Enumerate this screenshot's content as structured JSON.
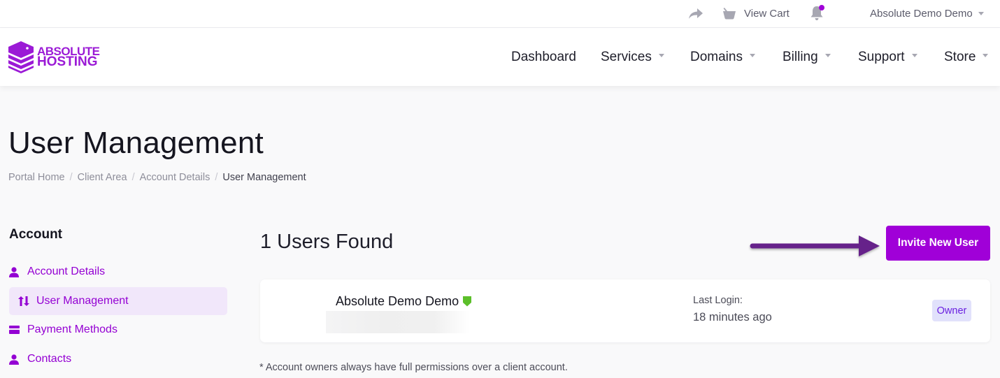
{
  "topbar": {
    "share_icon": "share-arrow-icon",
    "cart_icon": "basket-icon",
    "view_cart_label": "View Cart",
    "notifications_icon": "bell-icon",
    "user_menu_label": "Absolute Demo Demo"
  },
  "brand": {
    "line1": "ABSOLUTE",
    "line2": "HOSTING",
    "color": "#9b1ad6"
  },
  "nav": {
    "items": [
      {
        "label": "Dashboard",
        "has_dropdown": false
      },
      {
        "label": "Services",
        "has_dropdown": true
      },
      {
        "label": "Domains",
        "has_dropdown": true
      },
      {
        "label": "Billing",
        "has_dropdown": true
      },
      {
        "label": "Support",
        "has_dropdown": true
      },
      {
        "label": "Store",
        "has_dropdown": true
      }
    ]
  },
  "page": {
    "title": "User Management",
    "breadcrumb": [
      {
        "label": "Portal Home"
      },
      {
        "label": "Client Area"
      },
      {
        "label": "Account Details"
      },
      {
        "label": "User Management",
        "active": true
      }
    ]
  },
  "sidebar": {
    "title": "Account",
    "items": [
      {
        "label": "Account Details",
        "icon": "user-icon",
        "active": false
      },
      {
        "label": "User Management",
        "icon": "sort-arrows-icon",
        "active": true
      },
      {
        "label": "Payment Methods",
        "icon": "credit-card-icon",
        "active": false
      },
      {
        "label": "Contacts",
        "icon": "user-icon",
        "active": false
      }
    ]
  },
  "main": {
    "users_found": "1 Users Found",
    "invite_button": "Invite New User",
    "users": [
      {
        "name": "Absolute Demo Demo",
        "verified_icon": "shield-icon",
        "last_login_label": "Last Login:",
        "last_login_value": "18 minutes ago",
        "role": "Owner"
      }
    ],
    "footnote": "* Account owners always have full permissions over a client account."
  },
  "colors": {
    "accent": "#a000d8",
    "sidebar_active_bg": "#f1e7fa",
    "owner_badge_bg": "#e1e1fb",
    "owner_badge_text": "#6a1fe0",
    "verified_shield": "#5cbf2a",
    "annotation_arrow": "#66208a"
  }
}
